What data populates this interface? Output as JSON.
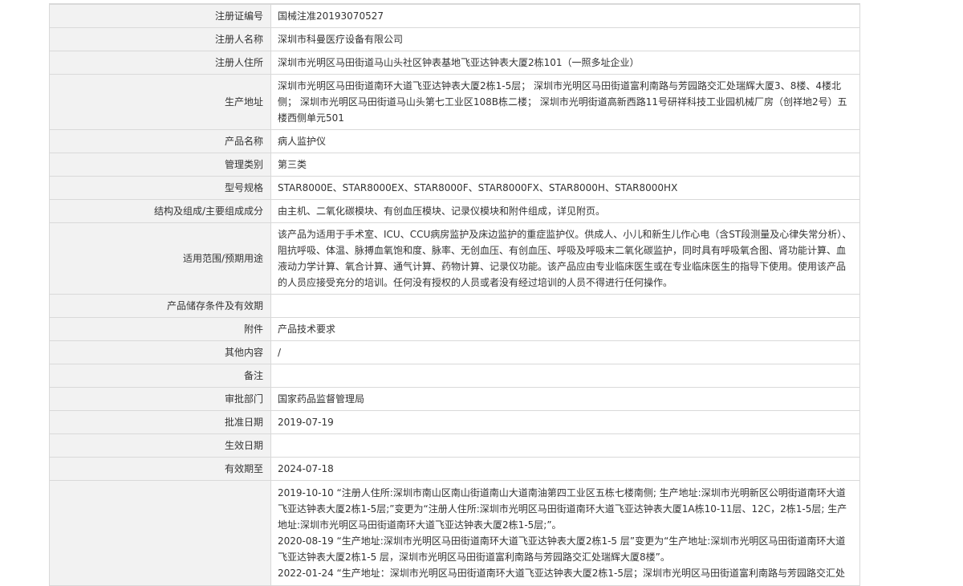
{
  "rows": [
    {
      "label": "注册证编号",
      "value": "国械注准20193070527"
    },
    {
      "label": "注册人名称",
      "value": "深圳市科曼医疗设备有限公司"
    },
    {
      "label": "注册人住所",
      "value": "深圳市光明区马田街道马山头社区钟表基地飞亚达钟表大厦2栋101（一照多址企业）"
    },
    {
      "label": "生产地址",
      "value": "深圳市光明区马田街道南环大道飞亚达钟表大厦2栋1-5层； 深圳市光明区马田街道富利南路与芳园路交汇处瑞辉大厦3、8楼、4楼北侧； 深圳市光明区马田街道马山头第七工业区108B栋二楼； 深圳市光明街道高新西路11号研祥科技工业园机械厂房（创祥地2号）五楼西侧单元501"
    },
    {
      "label": "产品名称",
      "value": "病人监护仪"
    },
    {
      "label": "管理类别",
      "value": "第三类"
    },
    {
      "label": "型号规格",
      "value": "STAR8000E、STAR8000EX、STAR8000F、STAR8000FX、STAR8000H、STAR8000HX"
    },
    {
      "label": "结构及组成/主要组成成分",
      "value": "由主机、二氧化碳模块、有创血压模块、记录仪模块和附件组成，详见附页。"
    },
    {
      "label": "适用范围/预期用途",
      "value": "该产品为适用于手术室、ICU、CCU病房监护及床边监护的重症监护仪。供成人、小儿和新生儿作心电（含ST段测量及心律失常分析）、阻抗呼吸、体温、脉搏血氧饱和度、脉率、无创血压、有创血压、呼吸及呼吸末二氧化碳监护，同时具有呼吸氧合图、肾功能计算、血液动力学计算、氧合计算、通气计算、药物计算、记录仪功能。该产品应由专业临床医生或在专业临床医生的指导下使用。使用该产品的人员应接受充分的培训。任何没有授权的人员或者没有经过培训的人员不得进行任何操作。"
    },
    {
      "label": "产品储存条件及有效期",
      "value": ""
    },
    {
      "label": "附件",
      "value": "产品技术要求"
    },
    {
      "label": "其他内容",
      "value": "/"
    },
    {
      "label": "备注",
      "value": ""
    },
    {
      "label": "审批部门",
      "value": "国家药品监督管理局"
    },
    {
      "label": "批准日期",
      "value": "2019-07-19"
    },
    {
      "label": "生效日期",
      "value": ""
    },
    {
      "label": "有效期至",
      "value": "2024-07-18"
    }
  ],
  "changes": [
    "2019-10-10 “注册人住所:深圳市南山区南山街道南山大道南油第四工业区五栋七楼南侧; 生产地址:深圳市光明新区公明街道南环大道飞亚达钟表大厦2栋1-5层;”变更为“注册人住所:深圳市光明区马田街道南环大道飞亚达钟表大厦1A栋10-11层、12C，2栋1-5层; 生产地址:深圳市光明区马田街道南环大道飞亚达钟表大厦2栋1-5层;”。",
    "2020-08-19 “生产地址:深圳市光明区马田街道南环大道飞亚达钟表大厦2栋1-5 层”变更为“生产地址:深圳市光明区马田街道南环大道飞亚达钟表大厦2栋1-5 层，深圳市光明区马田街道富利南路与芳园路交汇处瑞辉大厦8楼”。",
    "2022-01-24 “生产地址：深圳市光明区马田街道南环大道飞亚达钟表大厦2栋1-5层；深圳市光明区马田街道富利南路与芳园路交汇处"
  ]
}
